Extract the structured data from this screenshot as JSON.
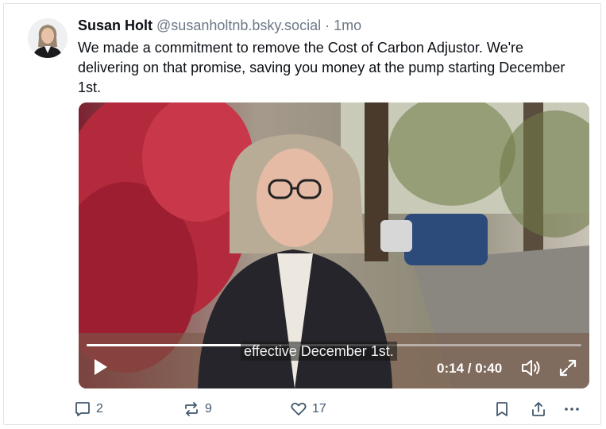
{
  "post": {
    "author_name": "Susan Holt",
    "handle": "@susanholtnb.bsky.social",
    "separator": "·",
    "time": "1mo",
    "text": "We made a commitment to remove the Cost of Carbon Adjustor. We're delivering on that promise, saving you money at the pump starting December 1st."
  },
  "video": {
    "caption": "effective December 1st.",
    "time_display": "0:14 / 0:40",
    "progress_fraction": 0.35,
    "icons": {
      "play": "play-icon",
      "volume": "volume-icon",
      "fullscreen": "fullscreen-icon"
    }
  },
  "actions": {
    "reply_count": "2",
    "repost_count": "9",
    "like_count": "17"
  },
  "colors": {
    "accent": "#42576c",
    "muted_text": "#6c7887",
    "border": "#dfe3e8"
  }
}
